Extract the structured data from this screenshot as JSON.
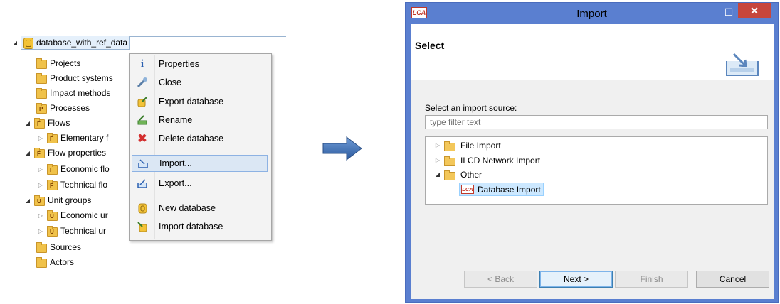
{
  "tree": {
    "root": {
      "label": "database_with_ref_data"
    },
    "items": [
      {
        "label": "Projects",
        "tag": ""
      },
      {
        "label": "Product systems",
        "tag": ""
      },
      {
        "label": "Impact methods",
        "tag": ""
      },
      {
        "label": "Processes",
        "tag": "P"
      },
      {
        "label": "Flows",
        "tag": "F"
      },
      {
        "label": "Elementary f",
        "tag": "F"
      },
      {
        "label": "Flow properties",
        "tag": "F"
      },
      {
        "label": "Economic flo",
        "tag": "F"
      },
      {
        "label": "Technical flo",
        "tag": "F"
      },
      {
        "label": "Unit groups",
        "tag": "U"
      },
      {
        "label": "Economic ur",
        "tag": "U"
      },
      {
        "label": "Technical ur",
        "tag": "U"
      },
      {
        "label": "Sources",
        "tag": ""
      },
      {
        "label": "Actors",
        "tag": ""
      }
    ]
  },
  "context_menu": {
    "items": [
      {
        "label": "Properties",
        "icon": "info-icon"
      },
      {
        "label": "Close",
        "icon": "close-db-icon"
      },
      {
        "label": "Export database",
        "icon": "export-database-icon"
      },
      {
        "label": "Rename",
        "icon": "rename-icon"
      },
      {
        "label": "Delete database",
        "icon": "delete-icon"
      },
      {
        "label": "Import...",
        "icon": "import-icon",
        "selected": true
      },
      {
        "label": "Export...",
        "icon": "export-icon"
      },
      {
        "label": "New database",
        "icon": "new-database-icon"
      },
      {
        "label": "Import database",
        "icon": "import-database-icon"
      }
    ]
  },
  "dialog": {
    "app_icon": "LCA",
    "title": "Import",
    "window_controls": {
      "minimize": "–",
      "maximize": "☐",
      "close": "✕"
    },
    "page_title": "Select",
    "source_label": "Select an import source:",
    "filter_placeholder": "type filter text",
    "sources": [
      {
        "label": "File Import",
        "expanded": false
      },
      {
        "label": "ILCD Network Import",
        "expanded": false
      },
      {
        "label": "Other",
        "expanded": true
      },
      {
        "label": "Database Import",
        "badge": "LCA",
        "selected": true
      }
    ],
    "buttons": {
      "back": "< Back",
      "next": "Next >",
      "finish": "Finish",
      "cancel": "Cancel"
    }
  },
  "colors": {
    "titlebar": "#5a7fd0",
    "close_button": "#c7463c",
    "selection": "#cce8ff",
    "arrow": "#3a6fb5"
  }
}
